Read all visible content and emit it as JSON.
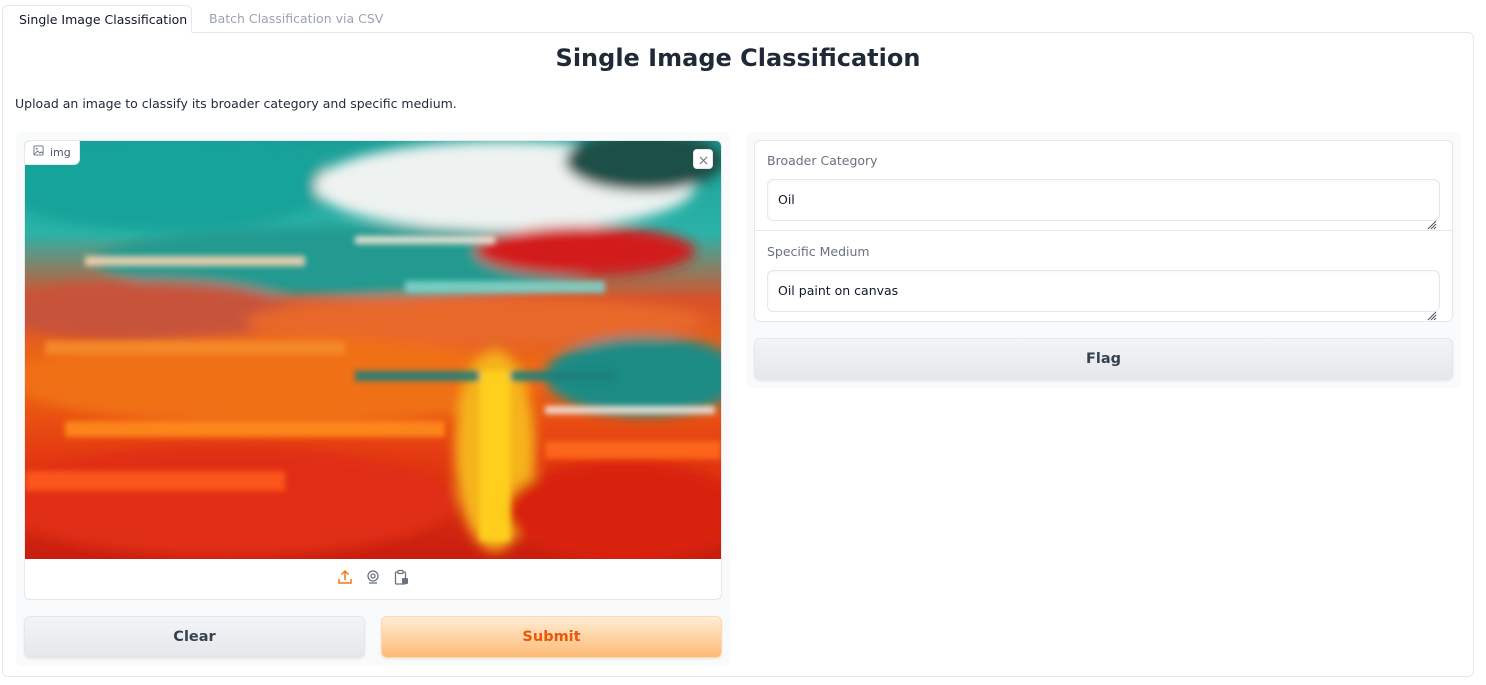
{
  "tabs": [
    {
      "label": "Single Image Classification",
      "active": true
    },
    {
      "label": "Batch Classification via CSV",
      "active": false
    }
  ],
  "page": {
    "title": "Single Image Classification",
    "description": "Upload an image to classify its broader category and specific medium."
  },
  "image_input": {
    "label": "img",
    "icon": "image-icon",
    "tools": [
      "upload-icon",
      "webcam-icon",
      "clipboard-icon"
    ]
  },
  "buttons": {
    "clear": "Clear",
    "submit": "Submit",
    "flag": "Flag"
  },
  "outputs": {
    "broader_category": {
      "label": "Broader Category",
      "value": "Oil"
    },
    "specific_medium": {
      "label": "Specific Medium",
      "value": "Oil paint on canvas"
    }
  },
  "colors": {
    "accent": "#ea580c",
    "submit_bg": "#fdba74",
    "border": "#e5e7eb"
  }
}
